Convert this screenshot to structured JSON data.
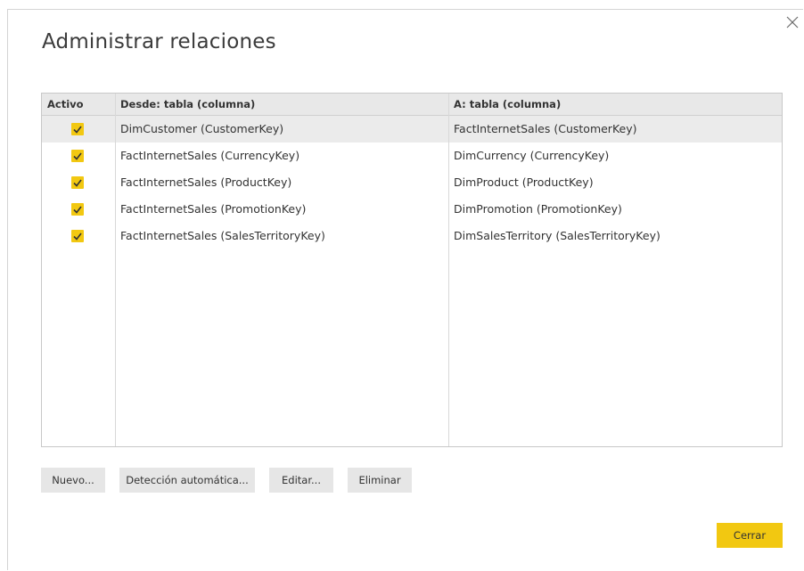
{
  "dialog": {
    "title": "Administrar relaciones",
    "close_icon": "close-x-icon"
  },
  "table": {
    "headers": {
      "active": "Activo",
      "from": "Desde: tabla (columna)",
      "to": "A: tabla (columna)"
    },
    "rows": [
      {
        "active": true,
        "from": "DimCustomer (CustomerKey)",
        "to": "FactInternetSales (CustomerKey)",
        "selected": true
      },
      {
        "active": true,
        "from": "FactInternetSales (CurrencyKey)",
        "to": "DimCurrency (CurrencyKey)",
        "selected": false
      },
      {
        "active": true,
        "from": "FactInternetSales (ProductKey)",
        "to": "DimProduct (ProductKey)",
        "selected": false
      },
      {
        "active": true,
        "from": "FactInternetSales (PromotionKey)",
        "to": "DimPromotion (PromotionKey)",
        "selected": false
      },
      {
        "active": true,
        "from": "FactInternetSales (SalesTerritoryKey)",
        "to": "DimSalesTerritory (SalesTerritoryKey)",
        "selected": false
      }
    ]
  },
  "actions": {
    "new_label": "Nuevo...",
    "autodetect_label": "Detección automática...",
    "edit_label": "Editar...",
    "delete_label": "Eliminar"
  },
  "footer": {
    "close_label": "Cerrar"
  },
  "colors": {
    "accent": "#f2c811",
    "selected_row": "#ebebeb",
    "header_bg": "#e8e8e8",
    "button_bg": "#e6e6e6"
  }
}
